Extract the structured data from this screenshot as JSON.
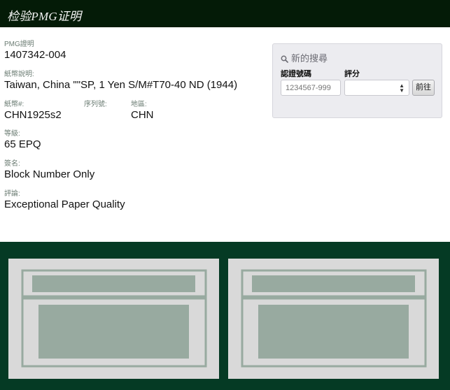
{
  "header": {
    "title": "检验PMG证明"
  },
  "certificate": {
    "pmg_cert": {
      "label": "PMG證明",
      "value": "1407342-004"
    },
    "note_desc": {
      "label": "紙幣說明:",
      "value": "Taiwan, China \"\"SP, 1 Yen S/M#T70-40 ND (1944)"
    },
    "note_no": {
      "label": "紙幣#:",
      "value": "CHN1925s2"
    },
    "serial_no": {
      "label": "序列號:",
      "value": ""
    },
    "region": {
      "label": "地區:",
      "value": "CHN"
    },
    "grade": {
      "label": "等級:",
      "value": "65 EPQ"
    },
    "signatures": {
      "label": "簽名:",
      "value": "Block Number Only"
    },
    "comments": {
      "label": "評論:",
      "value": "Exceptional Paper Quality"
    }
  },
  "search": {
    "heading": "新的搜尋",
    "cert_label": "認證號碼",
    "grade_label": "評分",
    "cert_placeholder": "1234567-999",
    "grade_selected": "",
    "go_label": "前往"
  },
  "colors": {
    "topbar": "#041b07",
    "green_band": "#053a24",
    "placeholder_frame": "#d9d9d9",
    "placeholder_fill": "#98aaa0"
  }
}
